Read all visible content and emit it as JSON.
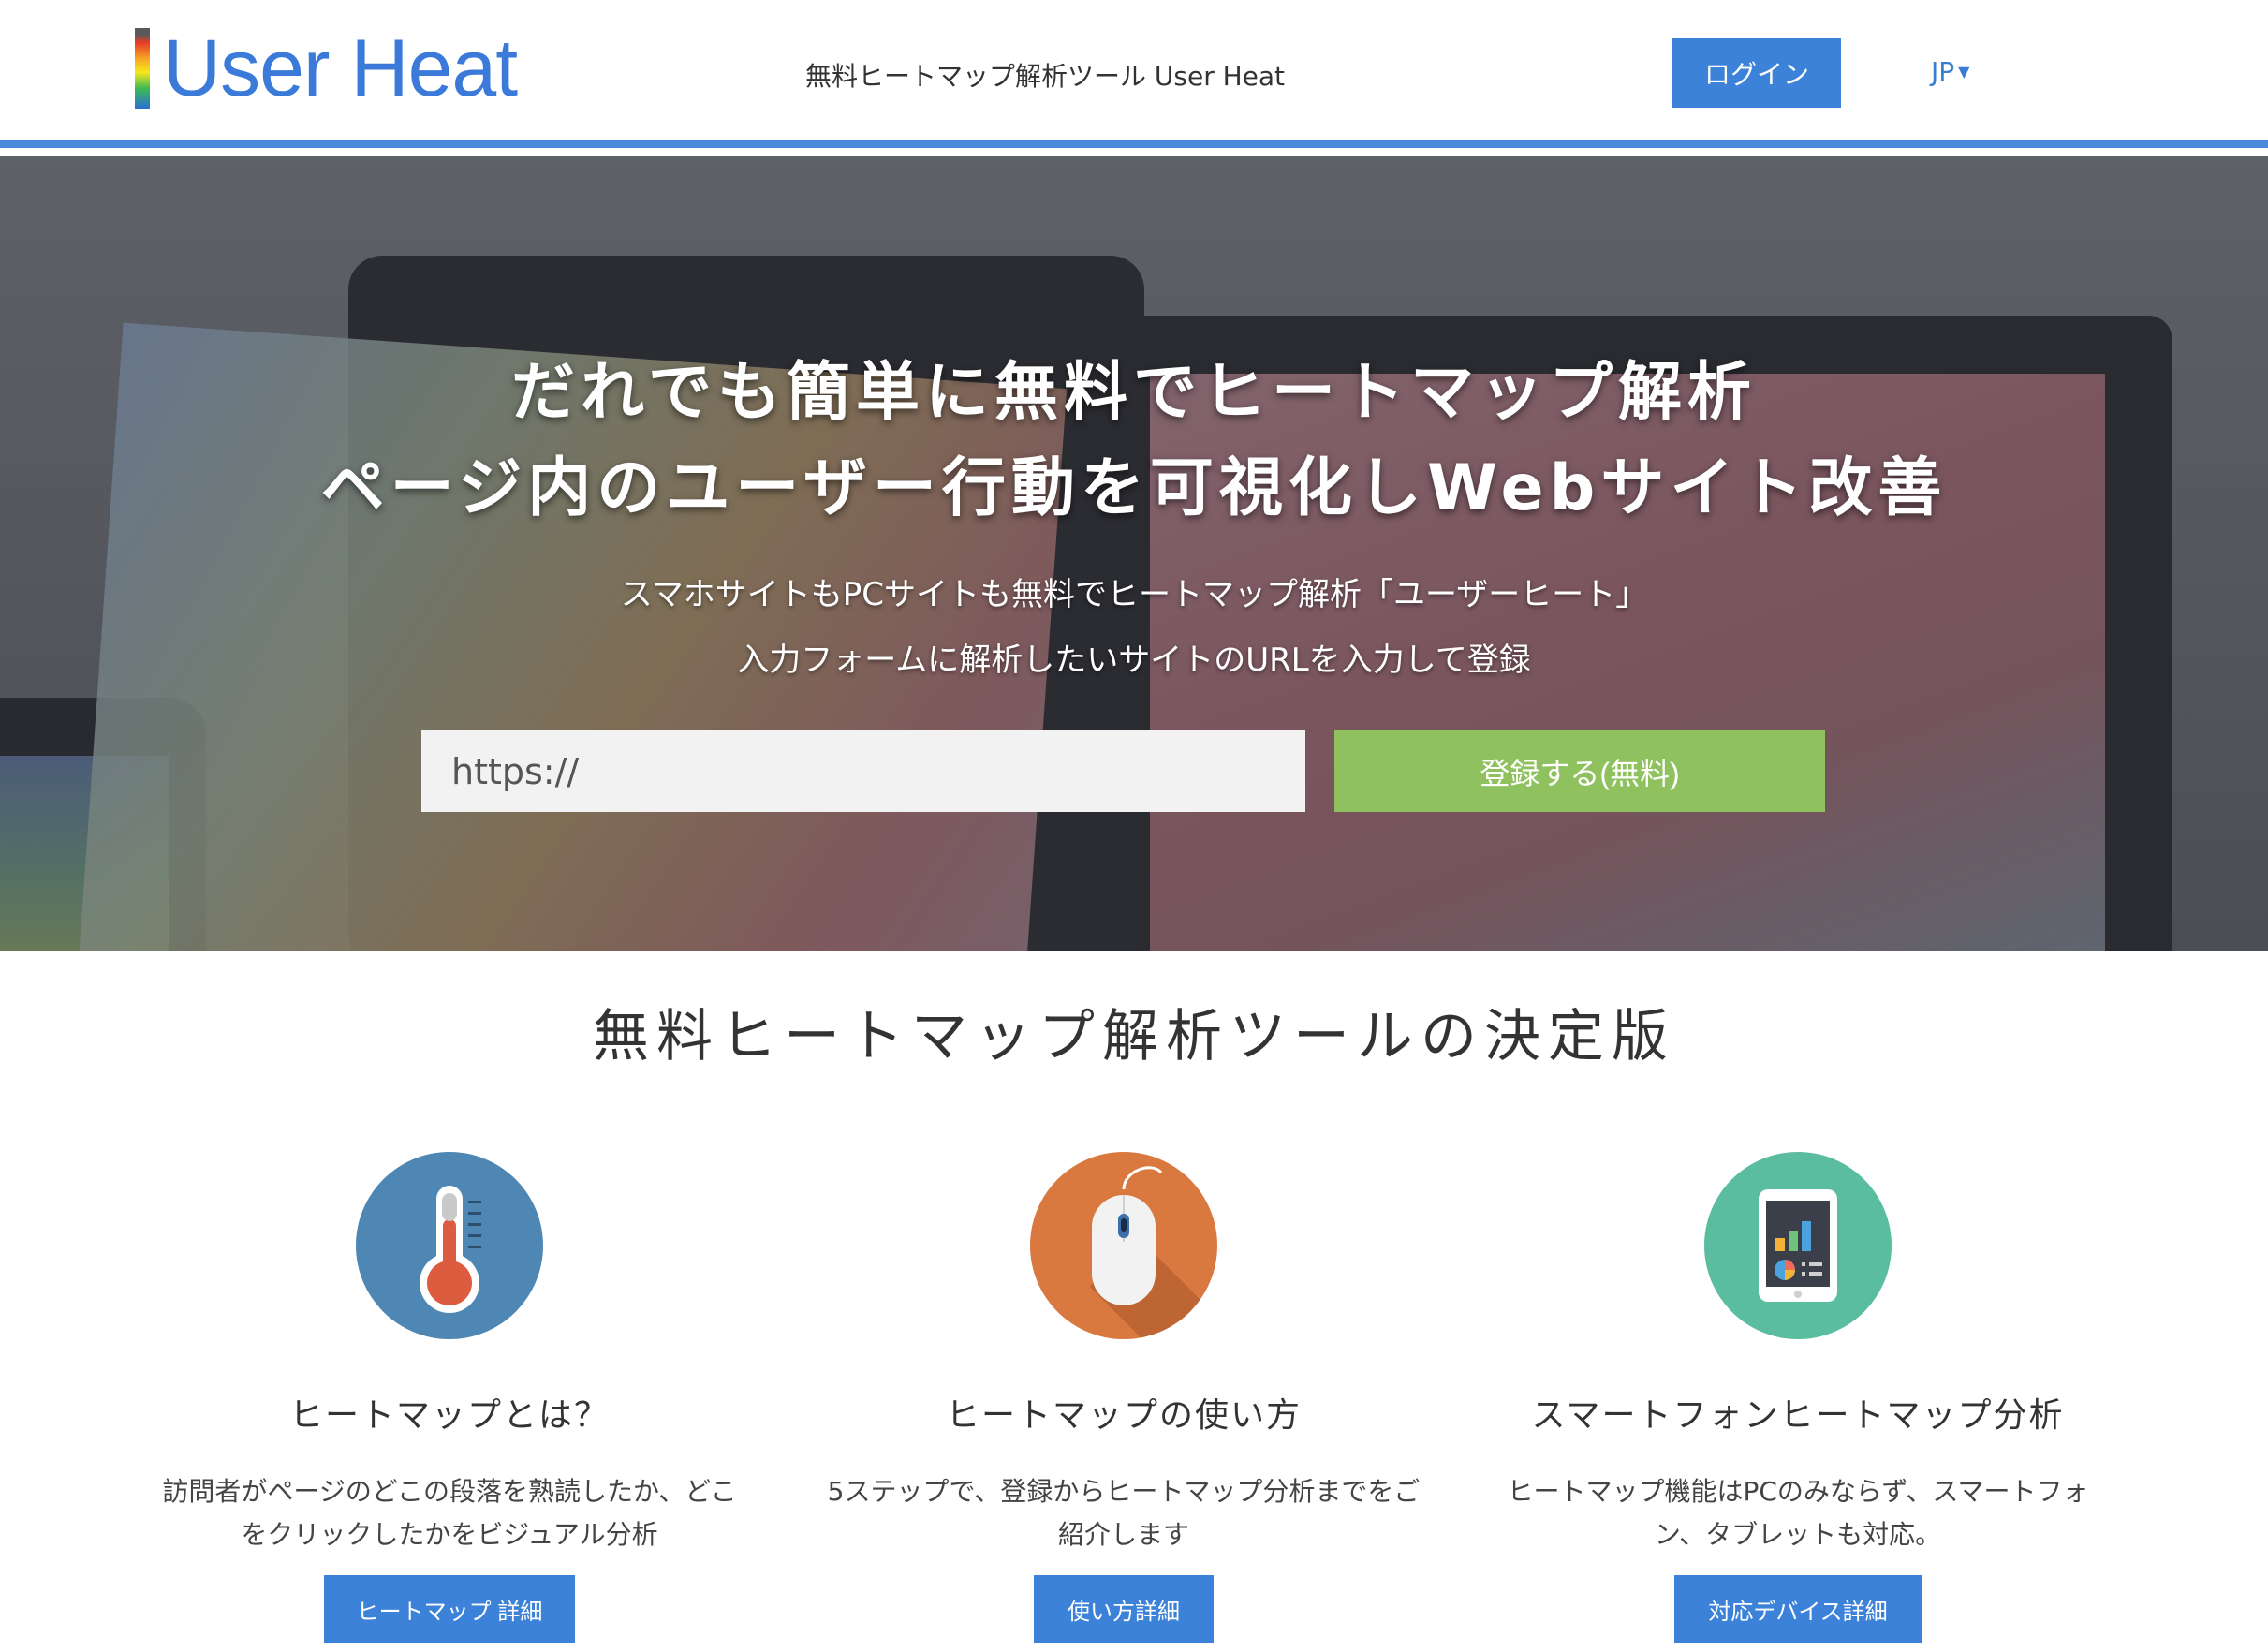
{
  "header": {
    "logo_text": "User Heat",
    "tagline": "無料ヒートマップ解析ツール User Heat",
    "login_label": "ログイン",
    "lang_label": "JP"
  },
  "hero": {
    "title_line1": "だれでも簡単に無料でヒートマップ解析",
    "title_line2": "ページ内のユーザー行動を可視化しWebサイト改善",
    "sub_line1": "スマホサイトもPCサイトも無料でヒートマップ解析「ユーザーヒート」",
    "sub_line2": "入力フォームに解析したいサイトのURLを入力して登録",
    "url_value": "https://",
    "register_label": "登録する(無料)"
  },
  "section": {
    "title": "無料ヒートマップ解析ツールの決定版"
  },
  "features": [
    {
      "icon": "thermometer-icon",
      "title": "ヒートマップとは？",
      "desc": "訪問者がページのどこの段落を熟読したか、どこをクリックしたかをビジュアル分析",
      "button": "ヒートマップ 詳細"
    },
    {
      "icon": "mouse-icon",
      "title": "ヒートマップの使い方",
      "desc": "5ステップで、登録からヒートマップ分析までをご紹介します",
      "button": "使い方詳細"
    },
    {
      "icon": "tablet-chart-icon",
      "title": "スマートフォンヒートマップ分析",
      "desc": "ヒートマップ機能はPCのみならず、スマートフォン、タブレットも対応。",
      "button": "対応デバイス詳細"
    }
  ],
  "colors": {
    "accent_blue": "#3c82d8",
    "register_green": "#8fc25f",
    "icon_blue": "#4f87b4",
    "icon_orange": "#d9783f",
    "icon_teal": "#5bbd9f"
  }
}
